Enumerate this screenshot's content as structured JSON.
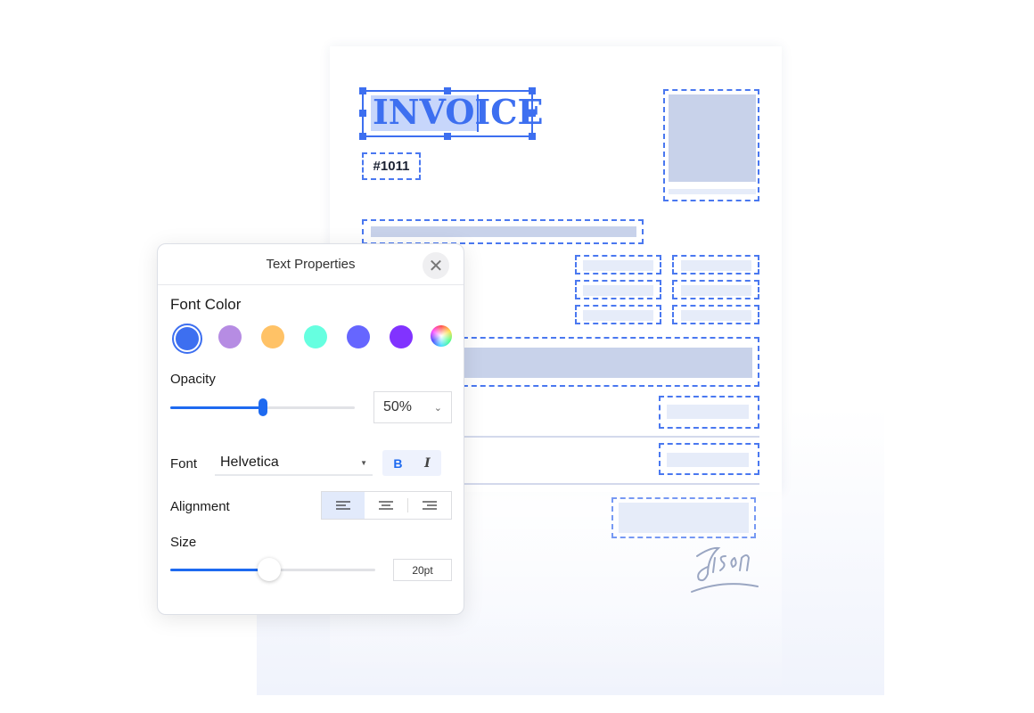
{
  "document": {
    "title": "INVOICE",
    "number": "#1011",
    "signature_text": "Jason"
  },
  "panel": {
    "title": "Text Properties",
    "close_icon": "close-icon",
    "font_color_label": "Font Color",
    "colors": [
      "#3d6ff0",
      "#b68ce3",
      "#ffc266",
      "#66ffe0",
      "#6666ff",
      "#8133ff",
      "rainbow"
    ],
    "selected_color": "#3d6ff0",
    "opacity_label": "Opacity",
    "opacity_value": "50%",
    "opacity_fraction": 0.5,
    "font_label": "Font",
    "font_value": "Helvetica",
    "bold_label": "B",
    "italic_label": "I",
    "bold_active": true,
    "alignment_label": "Alignment",
    "alignment_selected": "left",
    "size_label": "Size",
    "size_value": "20pt",
    "size_fraction": 0.48
  },
  "colors": {
    "accent": "#3d6ff0",
    "slider": "#1e6af0",
    "placeholder": "#c8d2ea"
  }
}
